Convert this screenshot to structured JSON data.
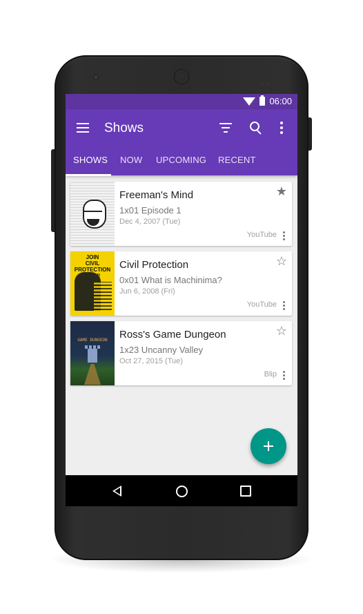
{
  "status_bar": {
    "time": "06:00"
  },
  "app_bar": {
    "title": "Shows"
  },
  "tabs": [
    {
      "label": "SHOWS",
      "active": true
    },
    {
      "label": "NOW",
      "active": false
    },
    {
      "label": "UPCOMING",
      "active": false
    },
    {
      "label": "RECENT",
      "active": false
    }
  ],
  "shows": [
    {
      "title": "Freeman's Mind",
      "episode": "1x01 Episode 1",
      "date": "Dec 4, 2007 (Tue)",
      "network": "YouTube",
      "favorite": true
    },
    {
      "title": "Civil Protection",
      "episode": "0x01 What is Machinima?",
      "date": "Jun 6, 2008 (Fri)",
      "network": "YouTube",
      "favorite": false
    },
    {
      "title": "Ross's Game Dungeon",
      "episode": "1x23 Uncanny Valley",
      "date": "Oct 27, 2015 (Tue)",
      "network": "Blip",
      "favorite": false
    }
  ],
  "posters": {
    "civil_protection": "JOIN\nCIVIL PROTECTION\nNOW!",
    "ross": "GAME DUNGEON"
  },
  "icons": {
    "favorite_on": "★",
    "favorite_off": "☆"
  },
  "colors": {
    "app_bar": "#673ab7",
    "status_bar": "#5e35a0",
    "fab": "#009688"
  }
}
